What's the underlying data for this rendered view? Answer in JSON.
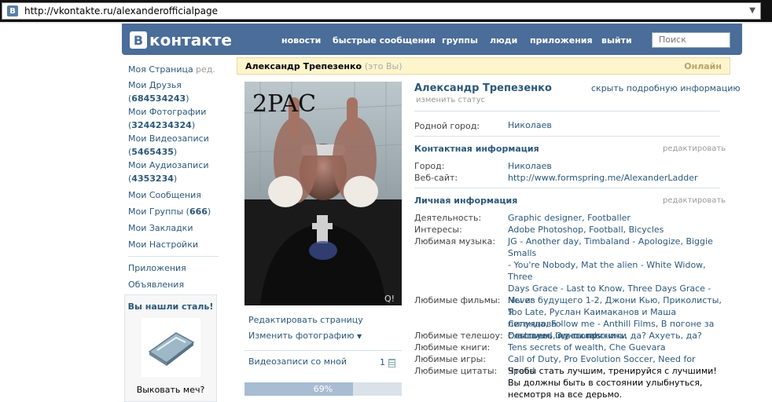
{
  "browser": {
    "url": "http://vkontakte.ru/alexanderofficialpage",
    "favicon": "B"
  },
  "header": {
    "logo_letter": "B",
    "logo_text": "контакте",
    "nav": [
      "новости",
      "быстрые сообщения",
      "группы",
      "люди",
      "приложения",
      "выйти"
    ],
    "search_placeholder": "Поиск"
  },
  "left_menu": {
    "my_page": "Моя Страница",
    "edit": "ред.",
    "friends": "Мои Друзья",
    "friends_count": "684534243",
    "photos": "Мои Фотографии",
    "photos_count": "3244234324",
    "videos": "Мои Видеозаписи",
    "videos_count": "5465435",
    "audio": "Мои Аудиозаписи",
    "audio_count": "4353234",
    "messages": "Мои Сообщения",
    "groups": "Мои Группы",
    "groups_count": "666",
    "bookmarks": "Мои Закладки",
    "settings": "Мои Настройки",
    "apps": "Приложения",
    "ads": "Объявления"
  },
  "ad": {
    "title": "Вы нашли сталь!",
    "caption": "Выковать меч?"
  },
  "profile": {
    "name": "Александр Трепезенко",
    "you": "(это Вы)",
    "online": "Онлайн",
    "photo_text": "2PAC",
    "photo_corner": "Q!",
    "edit_page": "Редактировать страницу",
    "change_photo": "Изменить фотографию",
    "videos_with_me": "Видеозаписи со мной",
    "videos_with_me_count": "1",
    "progress_label": "69%",
    "progress": 0.69,
    "status_link": "изменить статус",
    "hide_info": "скрыть подробную информацию"
  },
  "basic": {
    "hometown_label": "Родной город:",
    "hometown": "Николаев"
  },
  "contact": {
    "title": "Контактная информация",
    "edit": "редактировать",
    "city_label": "Город:",
    "city": "Николаев",
    "site_label": "Веб-сайт:",
    "site": "http://www.formspring.me/AlexanderLadder"
  },
  "personal": {
    "title": "Личная информация",
    "edit": "редактировать",
    "activity_label": "Деятельность:",
    "activity": "Graphic designer, Footballer",
    "interests_label": "Интересы:",
    "interests": "Adobe Photoshop, Football, Bicycles",
    "music_label": "Любимая музыка:",
    "music_lines": [
      "JG - Another day, Timbaland - Apologize, Biggie Smalls",
      "- You're Nobody, Mat the alien - White Widow, Three",
      "Days Grace - Last to Know, Three Days Grace - Never",
      "Too Late, Руслан Каимаканов и Маша Силуянова -",
      "Слышишь, ну ты прикинь, да? Ахуеть, да?"
    ],
    "movies_label": "Любимые фильмы:",
    "movies_lines": [
      "Мы из будущего 1-2, Джони Кью, Приколисты, Я",
      "легенда, Follow me - Anthill Films, В погоне за",
      "счастьем, Одноклассники"
    ],
    "tv_label": "Любимые телешоу:",
    "tv": "Destroyed in seconds",
    "books_label": "Любимые книги:",
    "books": "Tens secrets of wealth, Che Guevara",
    "games_label": "Любимые игры:",
    "games": "Call of Duty, Pro Evolution Soccer, Need for Speed",
    "quotes_label": "Любимые цитаты:",
    "quotes_lines": [
      "Чтобы стать лучшим, тренируйся с лучшими!",
      "Вы должны быть в состоянии улыбнуться,",
      "несмотря на все дерьмо."
    ]
  },
  "colors": {
    "brand": "#4a6d99",
    "link": "#2b587a",
    "highlight": "#fff5cc"
  }
}
